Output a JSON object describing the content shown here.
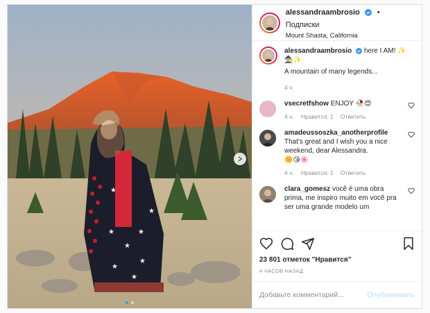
{
  "post": {
    "author": "alessandraambrosio",
    "follow_label": "• Подписки",
    "location": "Mount Shasta, California",
    "image_alt": "Photo in front of Mount Shasta at sunset"
  },
  "caption": {
    "author": "alessandraambrosio",
    "text": "here I AM!",
    "line2": "A mountain of many legends...",
    "time": "4 ч."
  },
  "comments": [
    {
      "author": "vsecretfshow",
      "text": "ENJOY",
      "time": "4 ч.",
      "likes": "Нравится: 1",
      "reply": "Ответить"
    },
    {
      "author": "amadeussoszka_anotherprofile",
      "text": "That's great and I wish you a nice weekend, dear Alessandra.",
      "time": "4 ч.",
      "likes": "Нравится: 1",
      "reply": "Ответить"
    },
    {
      "author": "clara_gomesz",
      "text": "você é uma obra prima, me inspiro muito em você pra ser uma grande modelo um"
    }
  ],
  "likes": {
    "text": "23 801 отметок \"Нравится\""
  },
  "timestamp": "4 ЧАСОВ НАЗАД",
  "add_comment": {
    "placeholder": "Добавьте комментарий...",
    "publish": "Опубликовать"
  },
  "colors": {
    "verified": "#3897f0",
    "link": "#b2dffc",
    "sky_top": "#a6b6c9",
    "mountain": "#e0602a"
  }
}
